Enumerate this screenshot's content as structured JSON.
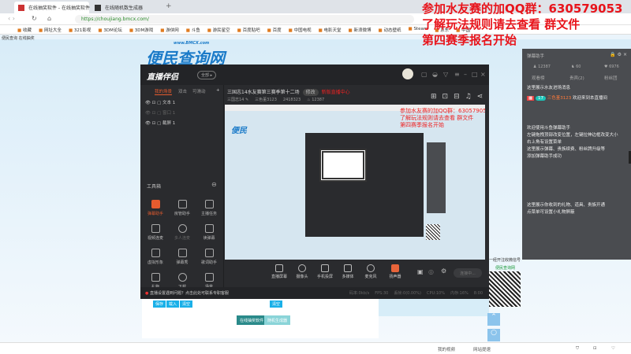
{
  "browser": {
    "tabs": [
      "在线抽奖软件 - 在线抽奖软件",
      "在线随机数生成器"
    ],
    "new_tab": "+",
    "url": "https://choujiang.bmcx.com/",
    "bookmarks": [
      "收藏",
      "网址大全",
      "321影视",
      "3DM论坛",
      "3DM游戏",
      "游侠网",
      "斗鱼",
      "游民星空",
      "百度贴吧",
      "百度",
      "中国电视",
      "电影天堂",
      "新浪微博",
      "动态壁纸",
      "Steam",
      "京东",
      "中国"
    ],
    "subline": "便民查询 在线抽奖"
  },
  "site": {
    "logo": "便民查询网",
    "logo_sub": "www.BMCX.com"
  },
  "overlay": {
    "lines": [
      "参加水友赛的加QQ群：630579053",
      "了解玩法规则请去查看 群文件",
      "第四赛季报名开始"
    ]
  },
  "app": {
    "logo": "直播伴侣",
    "badge": "全部 ▸",
    "left_tabs": [
      "我的场景",
      "双击",
      "可滑动"
    ],
    "add": "+",
    "sources": [
      "文本 1",
      "窗口 1",
      "截屏 1"
    ],
    "toolbox_title": "工具箱",
    "tools": [
      "弹幕助手",
      "房管助手",
      "主播任务",
      "视频连麦",
      "多人连麦",
      "读弹幕",
      "虚拟形象",
      "弹幕秀",
      "歌词助手",
      "礼物",
      "下载",
      "场景"
    ],
    "title": "三国志14水友赛第三赛季第十二场",
    "edit_badge": "修改",
    "live_label": "新版直播中心",
    "sub": {
      "category": "三国志14 ✎",
      "user": "三色堇3123",
      "id": "2418323",
      "hot": "♨ 12387"
    },
    "preview_red": [
      "参加水友赛的加QQ群：630579053",
      "了解玩法规则请去查看 群文件",
      "第四赛季报名开始"
    ],
    "controls": [
      "直播屏幕",
      "摄像头",
      "手机投屏",
      "多媒体",
      "麦克风",
      "扬声器"
    ],
    "connect": "连接中...",
    "help": "直播设置遇到问题？点击此处可联系专职客服",
    "stats": [
      "码率:0kb/s",
      "FPS:30",
      "丢帧:0(0.00%)",
      "CPU:10%",
      "内存:16%",
      "8:00"
    ]
  },
  "chat": {
    "title": "弹幕助手",
    "stats": [
      "♟ 12387",
      "♞ 60",
      "♥ 6976"
    ],
    "tabs": [
      "观看榜",
      "贵宾(2)",
      "粉丝团"
    ],
    "messages": [
      "这里展示水友进场消息",
      "欢迎来到本直播间",
      "欢迎使用斗鱼弹幕助手",
      "左键拖拽顶部改变位置，左键拉伸边框改变大小",
      "右上角有设置菜单",
      "这里展示弹幕、贵族续费、粉丝牌升级等",
      "添加弹幕助手成功",
      "这里展示你收到的礼物、道具、贵族开通",
      "点菜单可设置小礼物屏蔽"
    ],
    "level": "17",
    "user": "三色堇3123"
  },
  "content": {
    "buttons": [
      "保存",
      "载入",
      "清空"
    ],
    "clear2": "清空",
    "primary": "在线抽奖软件",
    "secondary": "随机生成器"
  },
  "qr": {
    "text": "一经开注收微信号",
    "link": "便民查询网"
  },
  "bottombar": {
    "items": [
      "我的视频",
      "网站提速"
    ]
  }
}
